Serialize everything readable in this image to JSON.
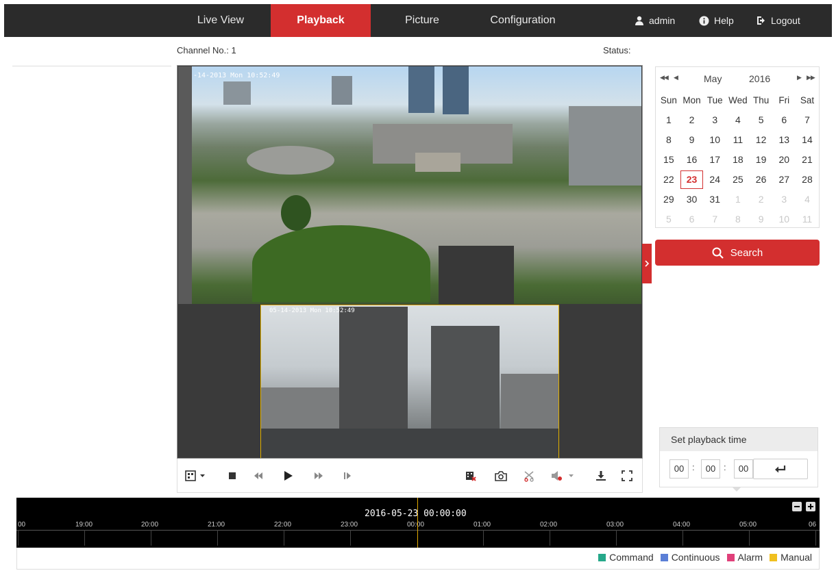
{
  "nav": {
    "tabs": [
      {
        "label": "Live View"
      },
      {
        "label": "Playback"
      },
      {
        "label": "Picture"
      },
      {
        "label": "Configuration"
      }
    ],
    "user": "admin",
    "help": "Help",
    "logout": "Logout"
  },
  "header": {
    "channel": "Channel No.: 1",
    "status": "Status:"
  },
  "video": {
    "main_osd": "-14-2013 Mon 10:52:49",
    "sub_osd": "05-14-2013 Mon 10:52:49"
  },
  "calendar": {
    "month": "May",
    "year": "2016",
    "weekdays": [
      "Sun",
      "Mon",
      "Tue",
      "Wed",
      "Thu",
      "Fri",
      "Sat"
    ],
    "weeks": [
      [
        "1",
        "2",
        "3",
        "4",
        "5",
        "6",
        "7"
      ],
      [
        "8",
        "9",
        "10",
        "11",
        "12",
        "13",
        "14"
      ],
      [
        "15",
        "16",
        "17",
        "18",
        "19",
        "20",
        "21"
      ],
      [
        "22",
        "23",
        "24",
        "25",
        "26",
        "27",
        "28"
      ],
      [
        "29",
        "30",
        "31",
        "1",
        "2",
        "3",
        "4"
      ],
      [
        "5",
        "6",
        "7",
        "8",
        "9",
        "10",
        "11"
      ]
    ],
    "selected": "23"
  },
  "search": {
    "label": "Search"
  },
  "playback_time": {
    "title": "Set playback time",
    "hour": "00",
    "minute": "00",
    "second": "00"
  },
  "timeline": {
    "current": "2016-05-23 00:00:00",
    "labels": [
      "00",
      "19:00",
      "20:00",
      "21:00",
      "22:00",
      "23:00",
      "00:00",
      "01:00",
      "02:00",
      "03:00",
      "04:00",
      "05:00",
      "06"
    ]
  },
  "legend": [
    {
      "label": "Command",
      "color": "#26a88a"
    },
    {
      "label": "Continuous",
      "color": "#5b7fd6"
    },
    {
      "label": "Alarm",
      "color": "#e0407a"
    },
    {
      "label": "Manual",
      "color": "#f0c020"
    }
  ],
  "colors": {
    "accent": "#d32f2f",
    "topbar": "#2b2b2b"
  }
}
